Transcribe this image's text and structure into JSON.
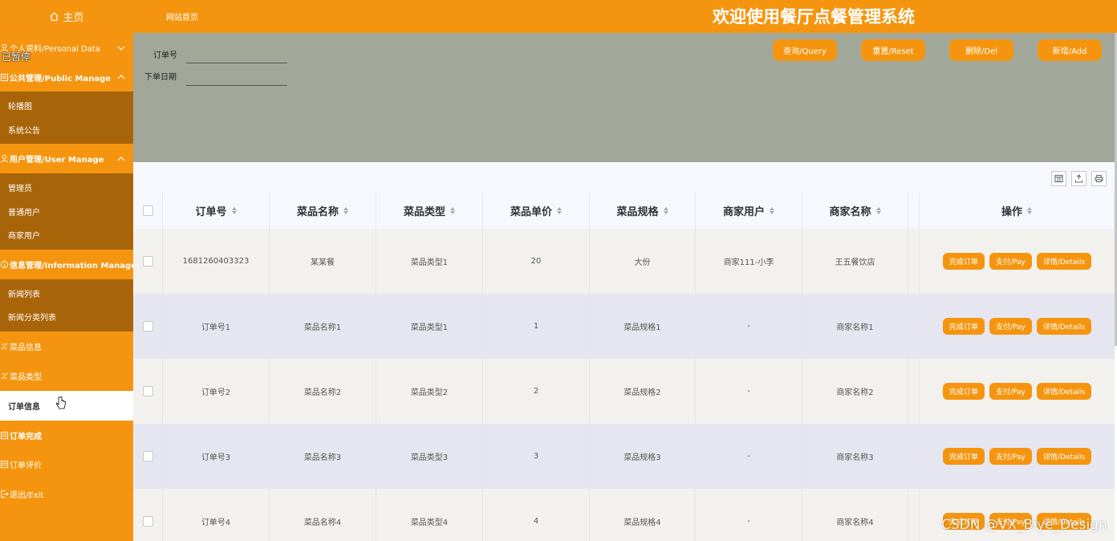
{
  "topbar": {
    "home_label": "主页",
    "site_link": "网站首页",
    "system_title": "欢迎使用餐厅点餐管理系统"
  },
  "overlay": {
    "paused_label": "已暂停",
    "watermark": "CSDN @VX_Biye_Design"
  },
  "sidebar": {
    "personal": "个人资料/Personal Data",
    "public": "公共管理/Public Manage",
    "public_items": [
      "轮播图",
      "系统公告"
    ],
    "user": "用户管理/User Manage",
    "user_items": [
      "管理员",
      "普通用户",
      "商家用户"
    ],
    "info": "信息管理/Information Manage",
    "info_items": [
      "新闻列表",
      "新闻分类列表"
    ],
    "dish_info": "菜品信息",
    "dish_type": "菜品类型",
    "order_info": "订单信息",
    "order_done": "订单完成",
    "order_review": "订单评价",
    "exit": "退出/Exit"
  },
  "search": {
    "order_no_label": "订单号",
    "order_date_label": "下单日期",
    "order_no_value": "",
    "order_date_value": "",
    "query": "查询/Query",
    "reset": "重置/Reset",
    "delete": "删除/Del",
    "add": "新增/Add"
  },
  "table": {
    "headers": [
      "订单号",
      "菜品名称",
      "菜品类型",
      "菜品单价",
      "菜品规格",
      "商家用户",
      "商家名称",
      "操作"
    ],
    "actions": [
      "完成订单",
      "支付/Pay",
      "详情/Details"
    ],
    "rows": [
      [
        "1681260403323",
        "某某餐",
        "菜品类型1",
        "20",
        "大份",
        "商家111-小李",
        "王五餐饮店"
      ],
      [
        "订单号1",
        "菜品名称1",
        "菜品类型1",
        "1",
        "菜品规格1",
        "-",
        "商家名称1"
      ],
      [
        "订单号2",
        "菜品名称2",
        "菜品类型2",
        "2",
        "菜品规格2",
        "-",
        "商家名称2"
      ],
      [
        "订单号3",
        "菜品名称3",
        "菜品类型3",
        "3",
        "菜品规格3",
        "-",
        "商家名称3"
      ],
      [
        "订单号4",
        "菜品名称4",
        "菜品类型4",
        "4",
        "菜品规格4",
        "-",
        "商家名称4"
      ]
    ]
  },
  "colors": {
    "accent": "#f5950f",
    "submenu": "#a86408",
    "search_panel": "#a1a89a"
  }
}
